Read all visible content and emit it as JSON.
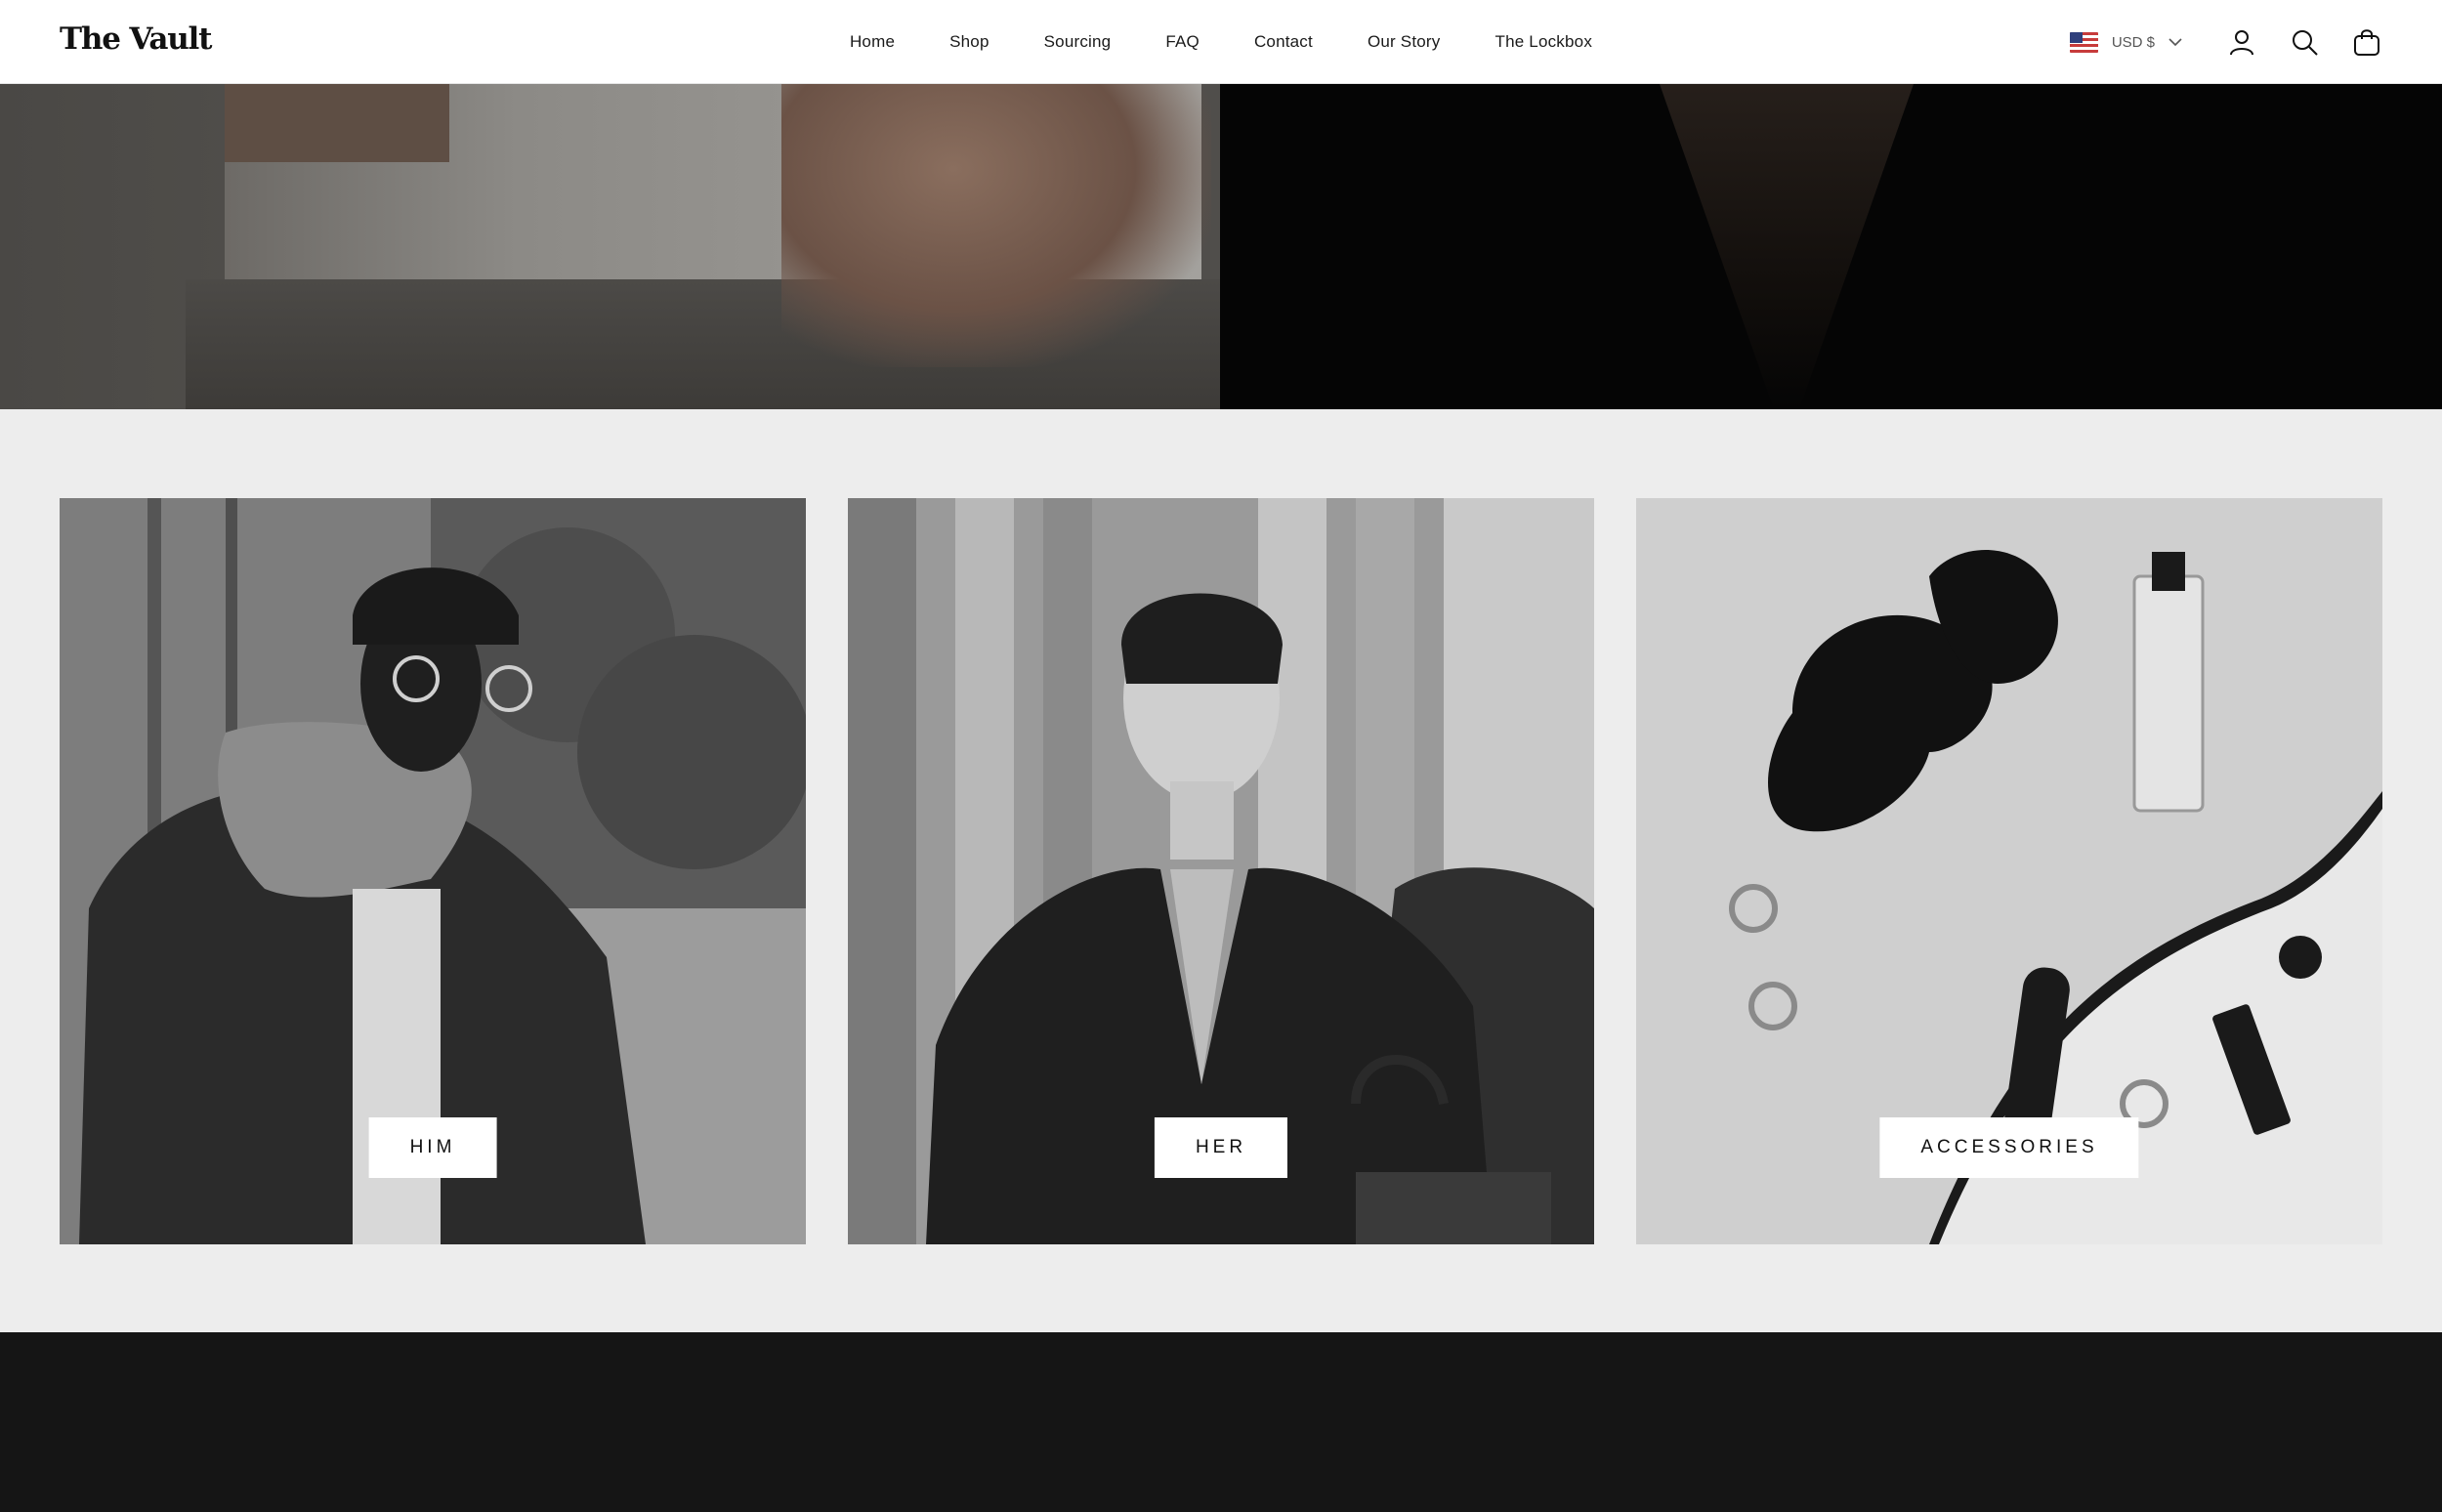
{
  "header": {
    "logo": "The Vault",
    "nav": [
      "Home",
      "Shop",
      "Sourcing",
      "FAQ",
      "Contact",
      "Our Story",
      "The Lockbox"
    ],
    "currency": "USD $",
    "icons": [
      "account-icon",
      "search-icon",
      "cart-icon"
    ]
  },
  "collections": [
    {
      "label": "HIM"
    },
    {
      "label": "HER"
    },
    {
      "label": "ACCESSORIES"
    }
  ],
  "colors": {
    "header_bg": "#ffffff",
    "page_bg": "#ededed",
    "footer_bg": "#151515",
    "text": "#111111"
  }
}
